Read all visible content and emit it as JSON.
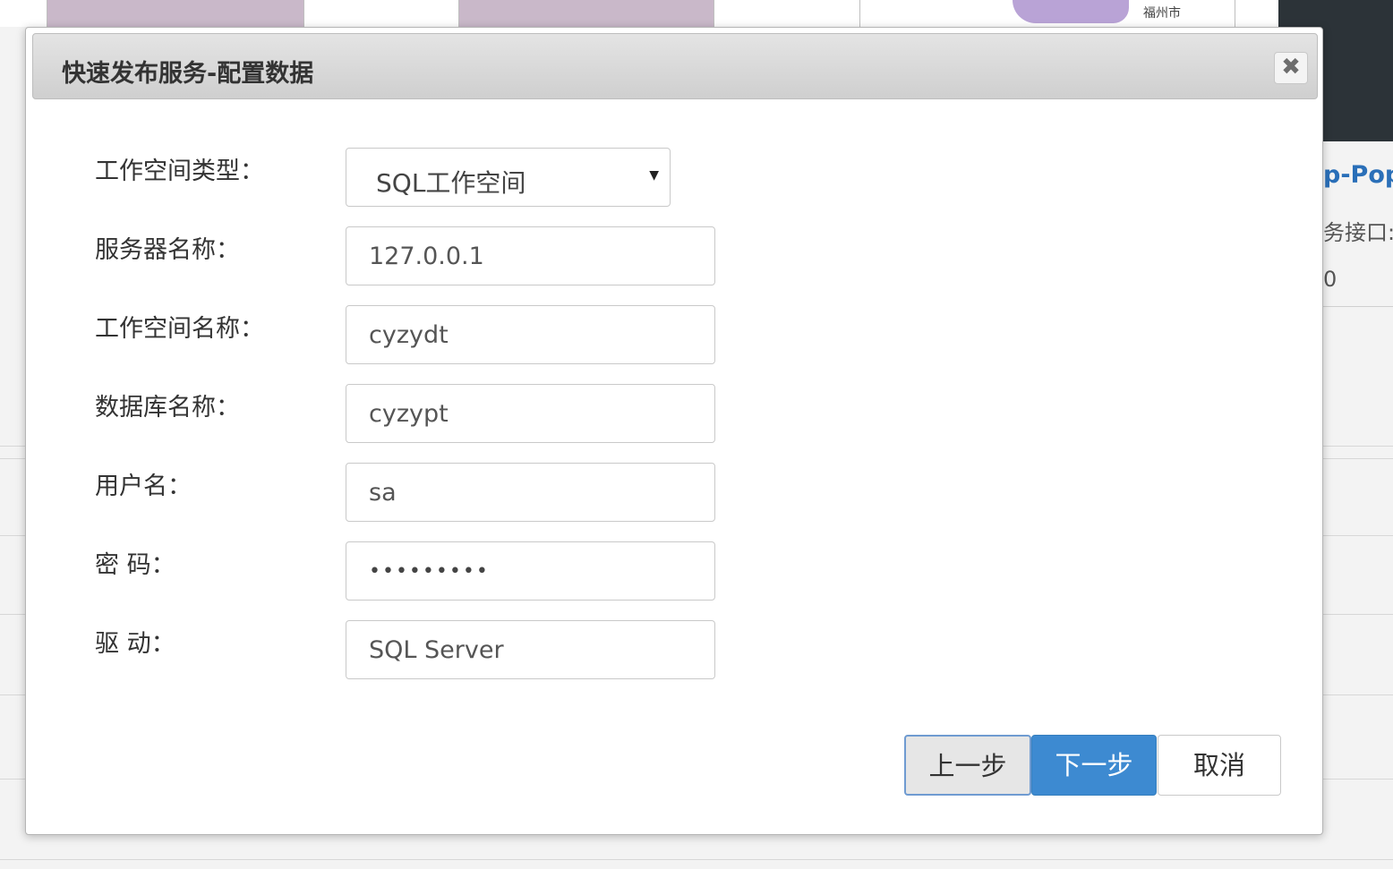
{
  "background": {
    "thumb_labels": [
      "福州市"
    ],
    "right_panel": {
      "title_fragment": "p-Pop",
      "subtitle_fragment": "务接口:",
      "value_fragment": "0"
    }
  },
  "modal": {
    "title": "快速发布服务-配置数据",
    "close_symbol": "✖",
    "fields": {
      "workspace_type": {
        "label": "工作空间类型：",
        "value": "SQL工作空间",
        "arrow": "▼"
      },
      "server_name": {
        "label": "服务器名称：",
        "value": "127.0.0.1"
      },
      "workspace_name": {
        "label": "工作空间名称：",
        "value": "cyzydt"
      },
      "database_name": {
        "label": "数据库名称：",
        "value": "cyzypt"
      },
      "username": {
        "label": "用户名：",
        "value": "sa"
      },
      "password": {
        "label": "密 码：",
        "value": "•••••••••"
      },
      "driver": {
        "label": "驱 动：",
        "value": "SQL Server"
      }
    },
    "buttons": {
      "prev": "上一步",
      "next": "下一步",
      "cancel": "取消"
    }
  },
  "colors": {
    "primary": "#3d8ad1",
    "link": "#2a6fb8",
    "dark_panel": "#2c3338"
  }
}
